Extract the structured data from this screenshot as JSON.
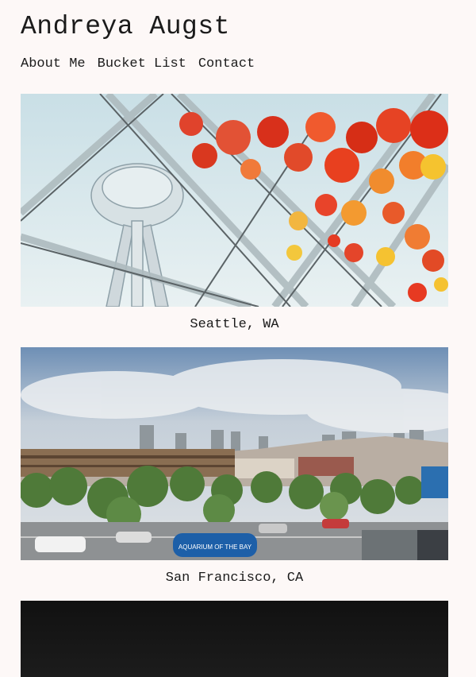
{
  "site": {
    "title": "Andreya Augst"
  },
  "nav": {
    "items": [
      {
        "label": "About Me"
      },
      {
        "label": "Bucket List"
      },
      {
        "label": "Contact"
      }
    ]
  },
  "gallery": {
    "items": [
      {
        "caption": "Seattle, WA"
      },
      {
        "caption": "San Francisco, CA",
        "sign_text": "AQUARIUM OF THE BAY"
      },
      {
        "caption": ""
      }
    ]
  },
  "colors": {
    "background": "#fdf8f7",
    "text": "#1b1b1b"
  }
}
